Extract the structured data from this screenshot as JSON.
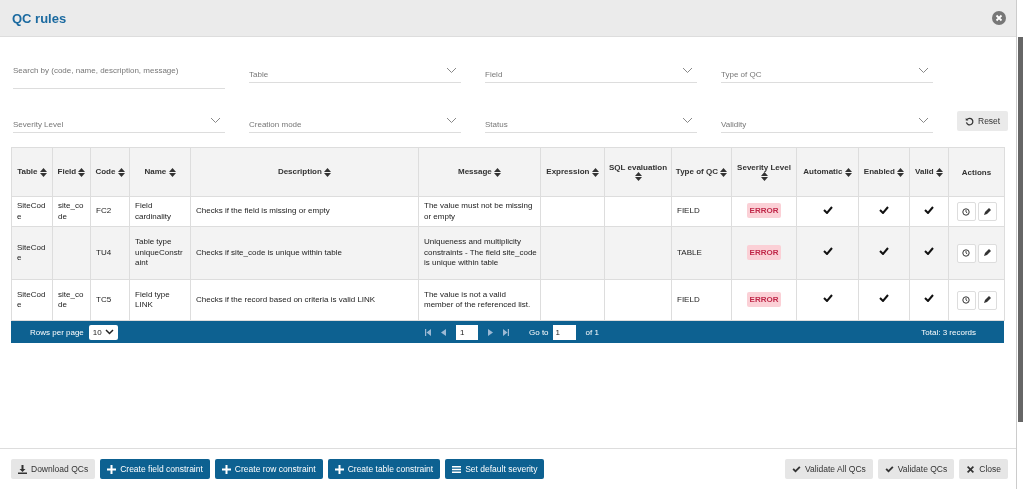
{
  "window": {
    "title": "QC rules"
  },
  "filters": [
    {
      "kind": "search",
      "placeholder": "Search by (code, name, description, message)"
    },
    {
      "kind": "select",
      "placeholder": "Table"
    },
    {
      "kind": "select",
      "placeholder": "Field"
    },
    {
      "kind": "select",
      "placeholder": "Type of QC"
    },
    {
      "kind": "select",
      "placeholder": "Severity Level"
    },
    {
      "kind": "select",
      "placeholder": "Creation mode"
    },
    {
      "kind": "select",
      "placeholder": "Status"
    },
    {
      "kind": "select",
      "placeholder": "Validity"
    }
  ],
  "reset_button": "Reset",
  "table": {
    "columns": [
      {
        "label": "Table",
        "sortable": true
      },
      {
        "label": "Field",
        "sortable": true
      },
      {
        "label": "Code",
        "sortable": true
      },
      {
        "label": "Name",
        "sortable": true
      },
      {
        "label": "Description",
        "sortable": true
      },
      {
        "label": "Message",
        "sortable": true
      },
      {
        "label": "Expression",
        "sortable": true
      },
      {
        "label": "SQL evaluation",
        "sortable": true
      },
      {
        "label": "Type of QC",
        "sortable": true
      },
      {
        "label": "Severity Level",
        "sortable": true
      },
      {
        "label": "Automatic",
        "sortable": true
      },
      {
        "label": "Enabled",
        "sortable": true
      },
      {
        "label": "Valid",
        "sortable": true
      },
      {
        "label": "Actions",
        "sortable": false
      }
    ],
    "rows": [
      {
        "table": "SiteCode",
        "field": "site_code",
        "code": "FC2",
        "name": "Field cardinality",
        "description": "Checks if the field is missing or empty",
        "message": "The value must not be missing or empty",
        "type": "FIELD",
        "severity": "ERROR",
        "automatic": true,
        "enabled": true,
        "valid": true
      },
      {
        "table": "SiteCode",
        "code": "TU4",
        "name": "Table type uniqueConstraint",
        "description": "Checks if site_code is unique within table",
        "message": "Uniqueness and multiplicity constraints - The field site_code is unique within table",
        "type": "TABLE",
        "severity": "ERROR",
        "automatic": true,
        "enabled": true,
        "valid": true
      },
      {
        "table": "SiteCode",
        "field": "site_code",
        "code": "TC5",
        "name": "Field type LINK",
        "description": "Checks if the record based on criteria is valid LINK",
        "message": "The value is not a valid member of the referenced list.",
        "type": "FIELD",
        "severity": "ERROR",
        "automatic": true,
        "enabled": true,
        "valid": true
      }
    ]
  },
  "pagination": {
    "rows_per_page_label": "Rows per page",
    "rows_per_page": "10",
    "page": "1",
    "goto_label": "Go to",
    "goto_value": "1",
    "of_label": "of 1",
    "total": "Total: 3 records"
  },
  "footer_buttons": [
    {
      "label": "Download QCs",
      "kind": "download",
      "primary": false
    },
    {
      "label": "Create field constraint",
      "kind": "create",
      "primary": true
    },
    {
      "label": "Create row constraint",
      "kind": "create",
      "primary": true
    },
    {
      "label": "Create table constraint",
      "kind": "create",
      "primary": true
    },
    {
      "label": "Set default severity",
      "kind": "severity",
      "primary": true
    }
  ],
  "footer_right_buttons": [
    {
      "label": "Validate All QCs",
      "kind": "validate",
      "primary": false
    },
    {
      "label": "Validate QCs",
      "kind": "validate",
      "primary": false
    },
    {
      "label": "Close",
      "kind": "close",
      "primary": false
    }
  ]
}
